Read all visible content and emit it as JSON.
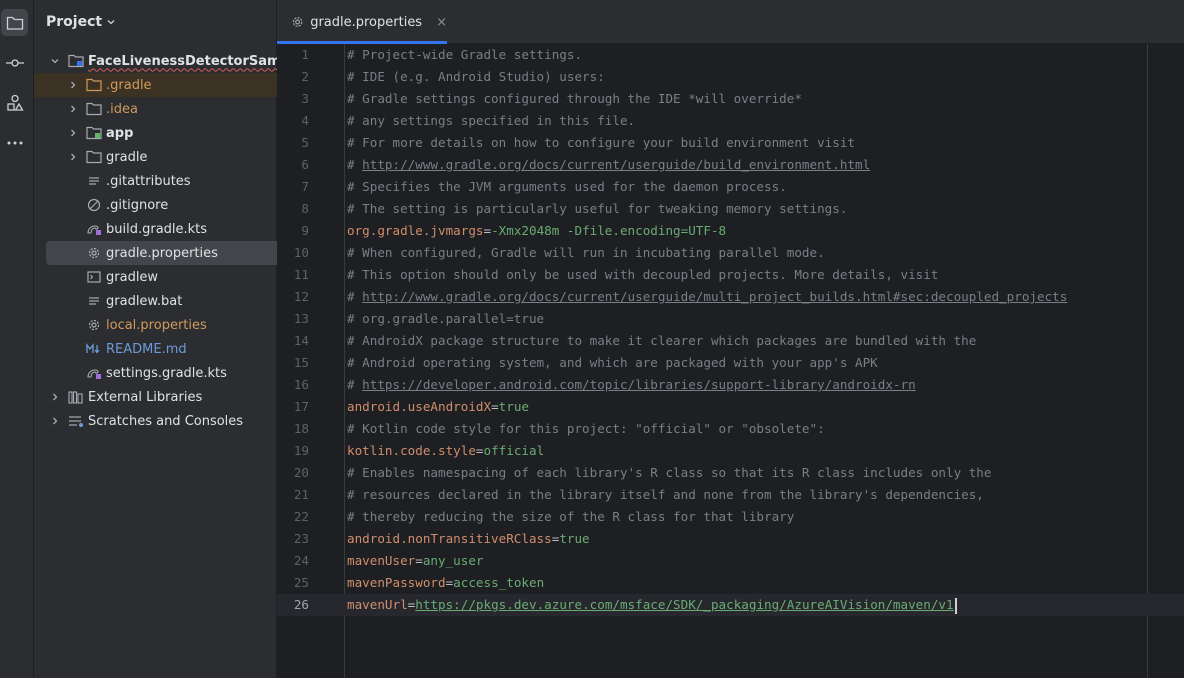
{
  "activity_bar": {
    "items": [
      {
        "name": "project-folder-icon",
        "active": true
      },
      {
        "name": "commit-icon",
        "active": false
      },
      {
        "name": "structure-icon",
        "active": false
      },
      {
        "name": "more-icon",
        "active": false
      }
    ]
  },
  "project_panel": {
    "title": "Project",
    "tree": [
      {
        "label": "FaceLivenessDetectorSample",
        "icon": "module-folder-icon",
        "expanded": true,
        "level": 0
      },
      {
        "label": ".gradle",
        "icon": "folder-icon",
        "expanded": false,
        "level": 1
      },
      {
        "label": ".idea",
        "icon": "folder-icon",
        "expanded": false,
        "level": 1
      },
      {
        "label": "app",
        "icon": "module-folder-icon",
        "expanded": false,
        "level": 1
      },
      {
        "label": "gradle",
        "icon": "folder-icon",
        "expanded": false,
        "level": 1
      },
      {
        "label": ".gitattributes",
        "icon": "text-file-icon",
        "level": 1
      },
      {
        "label": ".gitignore",
        "icon": "ignore-file-icon",
        "level": 1
      },
      {
        "label": "build.gradle.kts",
        "icon": "gradle-kts-icon",
        "level": 1
      },
      {
        "label": "gradle.properties",
        "icon": "properties-gear-icon",
        "level": 1,
        "selected": true
      },
      {
        "label": "gradlew",
        "icon": "terminal-file-icon",
        "level": 1
      },
      {
        "label": "gradlew.bat",
        "icon": "text-file-icon",
        "level": 1
      },
      {
        "label": "local.properties",
        "icon": "properties-gear-icon",
        "level": 1
      },
      {
        "label": "README.md",
        "icon": "markdown-icon",
        "level": 1
      },
      {
        "label": "settings.gradle.kts",
        "icon": "gradle-kts-icon",
        "level": 1
      },
      {
        "label": "External Libraries",
        "icon": "libraries-icon",
        "expanded": false,
        "level": 0
      },
      {
        "label": "Scratches and Consoles",
        "icon": "scratches-icon",
        "expanded": false,
        "level": 0
      }
    ]
  },
  "editor_tab": {
    "label": "gradle.properties",
    "close": "×"
  },
  "editor": {
    "current_line": 26,
    "lines": [
      {
        "n": "1",
        "segs": [
          {
            "t": "# Project-wide Gradle settings.",
            "c": "cmt"
          }
        ]
      },
      {
        "n": "2",
        "segs": [
          {
            "t": "# IDE (e.g. Android Studio) users:",
            "c": "cmt"
          }
        ]
      },
      {
        "n": "3",
        "segs": [
          {
            "t": "# Gradle settings configured through the IDE *will override*",
            "c": "cmt"
          }
        ]
      },
      {
        "n": "4",
        "segs": [
          {
            "t": "# any settings specified in this file.",
            "c": "cmt"
          }
        ]
      },
      {
        "n": "5",
        "segs": [
          {
            "t": "# For more details on how to configure your build environment visit",
            "c": "cmt"
          }
        ]
      },
      {
        "n": "6",
        "segs": [
          {
            "t": "# ",
            "c": "cmt"
          },
          {
            "t": "http://www.gradle.org/docs/current/userguide/build_environment.html",
            "c": "url"
          }
        ]
      },
      {
        "n": "7",
        "segs": [
          {
            "t": "# Specifies the JVM arguments used for the daemon process.",
            "c": "cmt"
          }
        ]
      },
      {
        "n": "8",
        "segs": [
          {
            "t": "# The setting is particularly useful for tweaking memory settings.",
            "c": "cmt"
          }
        ]
      },
      {
        "n": "9",
        "segs": [
          {
            "t": "org.gradle.jvmargs",
            "c": "key"
          },
          {
            "t": "=",
            "c": "eq"
          },
          {
            "t": "-Xmx2048m -Dfile.encoding=UTF-8",
            "c": "val"
          }
        ]
      },
      {
        "n": "10",
        "segs": [
          {
            "t": "# When configured, Gradle will run in incubating parallel mode.",
            "c": "cmt"
          }
        ]
      },
      {
        "n": "11",
        "segs": [
          {
            "t": "# This option should only be used with decoupled projects. More details, visit",
            "c": "cmt"
          }
        ]
      },
      {
        "n": "12",
        "segs": [
          {
            "t": "# ",
            "c": "cmt"
          },
          {
            "t": "http://www.gradle.org/docs/current/userguide/multi_project_builds.html#sec:decoupled_projects",
            "c": "url"
          }
        ]
      },
      {
        "n": "13",
        "segs": [
          {
            "t": "# org.gradle.parallel=true",
            "c": "cmt"
          }
        ]
      },
      {
        "n": "14",
        "segs": [
          {
            "t": "# AndroidX package structure to make it clearer which packages are bundled with the",
            "c": "cmt"
          }
        ]
      },
      {
        "n": "15",
        "segs": [
          {
            "t": "# Android operating system, and which are packaged with your app's APK",
            "c": "cmt"
          }
        ]
      },
      {
        "n": "16",
        "segs": [
          {
            "t": "# ",
            "c": "cmt"
          },
          {
            "t": "https://developer.android.com/topic/libraries/support-library/androidx-rn",
            "c": "url"
          }
        ]
      },
      {
        "n": "17",
        "segs": [
          {
            "t": "android.useAndroidX",
            "c": "key"
          },
          {
            "t": "=",
            "c": "eq"
          },
          {
            "t": "true",
            "c": "val"
          }
        ]
      },
      {
        "n": "18",
        "segs": [
          {
            "t": "# Kotlin code style for this project: \"official\" or \"obsolete\":",
            "c": "cmt"
          }
        ]
      },
      {
        "n": "19",
        "segs": [
          {
            "t": "kotlin.code.style",
            "c": "key"
          },
          {
            "t": "=",
            "c": "eq"
          },
          {
            "t": "official",
            "c": "val"
          }
        ]
      },
      {
        "n": "20",
        "segs": [
          {
            "t": "# Enables namespacing of each library's R class so that its R class includes only the",
            "c": "cmt"
          }
        ]
      },
      {
        "n": "21",
        "segs": [
          {
            "t": "# resources declared in the library itself and none from the library's dependencies,",
            "c": "cmt"
          }
        ]
      },
      {
        "n": "22",
        "segs": [
          {
            "t": "# thereby reducing the size of the R class for that library",
            "c": "cmt"
          }
        ]
      },
      {
        "n": "23",
        "segs": [
          {
            "t": "android.nonTransitiveRClass",
            "c": "key"
          },
          {
            "t": "=",
            "c": "eq"
          },
          {
            "t": "true",
            "c": "val"
          }
        ]
      },
      {
        "n": "24",
        "segs": [
          {
            "t": "mavenUser",
            "c": "key"
          },
          {
            "t": "=",
            "c": "eq"
          },
          {
            "t": "any_user",
            "c": "val"
          }
        ]
      },
      {
        "n": "25",
        "segs": [
          {
            "t": "mavenPassword",
            "c": "key"
          },
          {
            "t": "=",
            "c": "eq"
          },
          {
            "t": "access_token",
            "c": "val"
          }
        ]
      },
      {
        "n": "26",
        "segs": [
          {
            "t": "mavenUrl",
            "c": "key"
          },
          {
            "t": "=",
            "c": "eq"
          },
          {
            "t": "https://pkgs.dev.azure.com/msface/SDK/_packaging/AzureAIVision/maven/v1",
            "c": "val-url"
          }
        ]
      }
    ]
  },
  "colors": {
    "accent": "#3574f0",
    "comment": "#7a7e85",
    "key": "#cf8e6d",
    "value": "#6aab73",
    "folder_orange": "#d09a5c"
  }
}
